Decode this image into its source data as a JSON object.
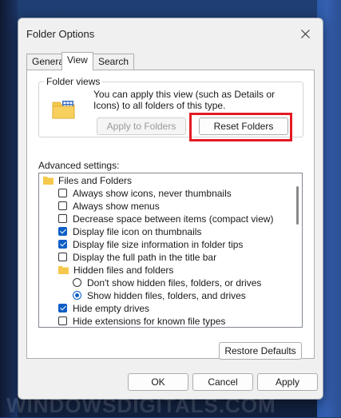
{
  "window": {
    "title": "Folder Options"
  },
  "tabs": [
    {
      "label": "General"
    },
    {
      "label": "View"
    },
    {
      "label": "Search"
    }
  ],
  "folder_views": {
    "legend": "Folder views",
    "description": "You can apply this view (such as Details or Icons) to all folders of this type.",
    "apply_button": "Apply to Folders",
    "reset_button": "Reset Folders"
  },
  "advanced": {
    "label": "Advanced settings:",
    "items": [
      {
        "type": "folder",
        "label": "Files and Folders"
      },
      {
        "type": "checkbox",
        "label": "Always show icons, never thumbnails",
        "checked": false
      },
      {
        "type": "checkbox",
        "label": "Always show menus",
        "checked": false
      },
      {
        "type": "checkbox",
        "label": "Decrease space between items (compact view)",
        "checked": false
      },
      {
        "type": "checkbox",
        "label": "Display file icon on thumbnails",
        "checked": true
      },
      {
        "type": "checkbox",
        "label": "Display file size information in folder tips",
        "checked": true
      },
      {
        "type": "checkbox",
        "label": "Display the full path in the title bar",
        "checked": false
      },
      {
        "type": "folder",
        "label": "Hidden files and folders"
      },
      {
        "type": "radio",
        "label": "Don't show hidden files, folders, or drives",
        "checked": false
      },
      {
        "type": "radio",
        "label": "Show hidden files, folders, and drives",
        "checked": true
      },
      {
        "type": "checkbox",
        "label": "Hide empty drives",
        "checked": true
      },
      {
        "type": "checkbox",
        "label": "Hide extensions for known file types",
        "checked": false
      }
    ]
  },
  "restore_defaults": "Restore Defaults",
  "footer": {
    "ok": "OK",
    "cancel": "Cancel",
    "apply": "Apply"
  },
  "watermark": "WINDOWSDIGITALS.COM",
  "colors": {
    "accent": "#0e5fc7",
    "highlight": "#e31b23",
    "folder": "#f5c84c"
  }
}
